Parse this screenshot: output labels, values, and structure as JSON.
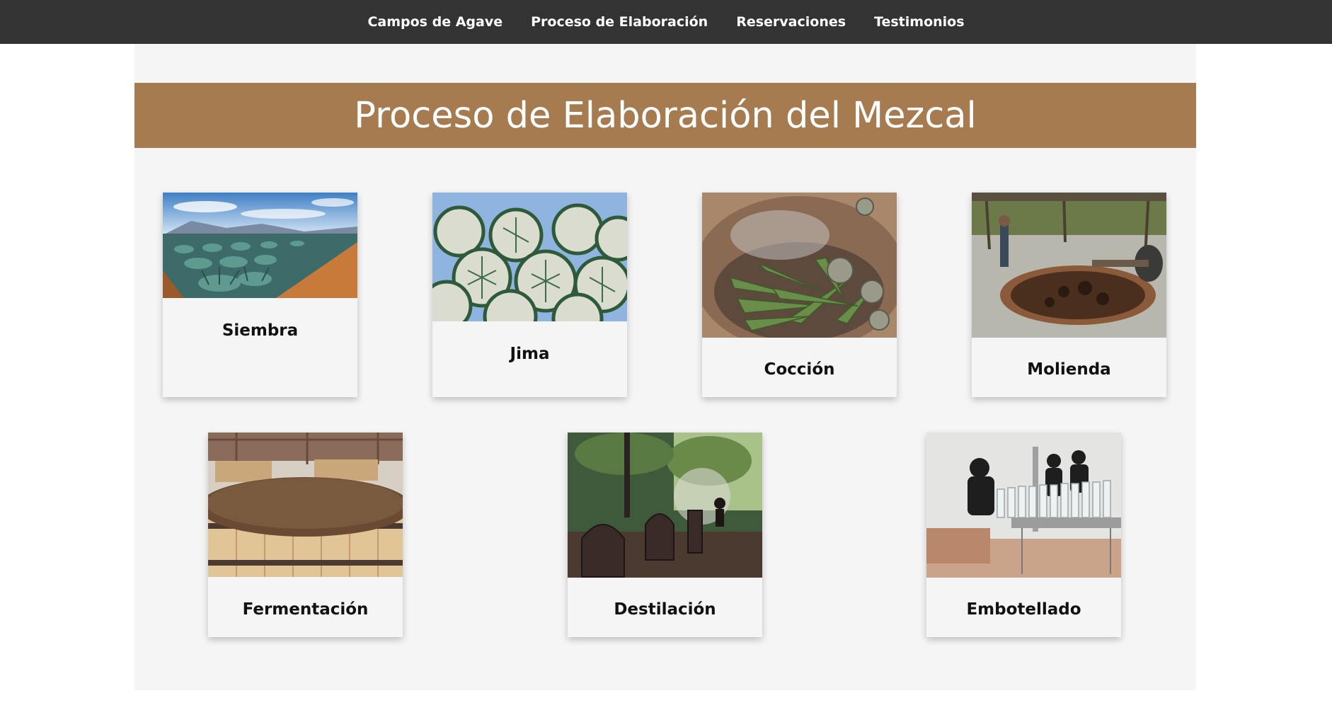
{
  "nav": {
    "links": [
      "Campos de Agave",
      "Proceso de Elaboración",
      "Reservaciones",
      "Testimonios"
    ]
  },
  "banner": {
    "title": "Proceso de Elaboración del Mezcal"
  },
  "steps": [
    {
      "label": "Siembra"
    },
    {
      "label": "Jima"
    },
    {
      "label": "Cocción"
    },
    {
      "label": "Molienda"
    },
    {
      "label": "Fermentación"
    },
    {
      "label": "Destilación"
    },
    {
      "label": "Embotellado"
    }
  ],
  "colors": {
    "navbar": "#333333",
    "banner": "#a67b50",
    "panel": "#f5f5f5"
  }
}
